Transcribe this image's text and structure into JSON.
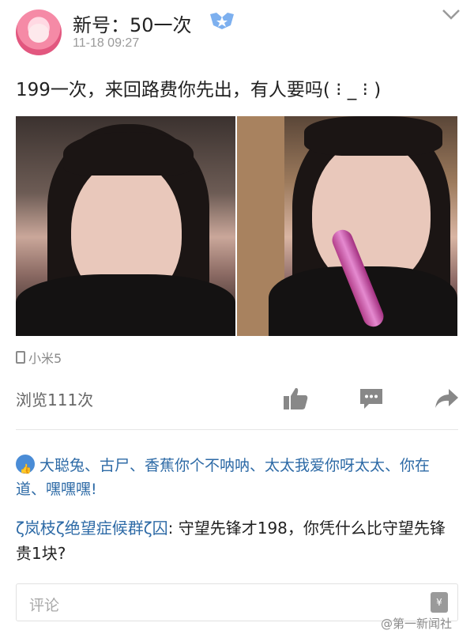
{
  "post": {
    "username": "新号：50一次",
    "timestamp": "11-18 09:27",
    "text": "199一次，来回路费你先出，有人要吗( ⁝ _ ⁝ )",
    "device": "小米5",
    "views": "浏览111次",
    "images": [
      {
        "description": "selfie photo 1"
      },
      {
        "description": "selfie photo 2"
      }
    ]
  },
  "likes": {
    "names": "大聪兔、古尸、香蕉你个不呐呐、太太我爱你呀太太、你在道、嘿嘿嘿!"
  },
  "comment": {
    "author": "ζ岚枝ζ绝望症候群ζ囚",
    "text": ": 守望先锋才198，你凭什么比守望先锋贵1块?"
  },
  "comment_input": {
    "placeholder": "评论"
  },
  "watermark": "@第一新闻社",
  "colors": {
    "link": "#2d6aa6",
    "like_badge": "#4a8cd6",
    "icon_gray": "#888888"
  },
  "icons": {
    "avatar": "avatar-image",
    "badge": "vip-badge-icon",
    "menu": "chevron-down-icon",
    "like": "thumbs-up-icon",
    "comment": "comment-bubble-icon",
    "share": "share-arrow-icon",
    "gift": "gift-icon"
  }
}
